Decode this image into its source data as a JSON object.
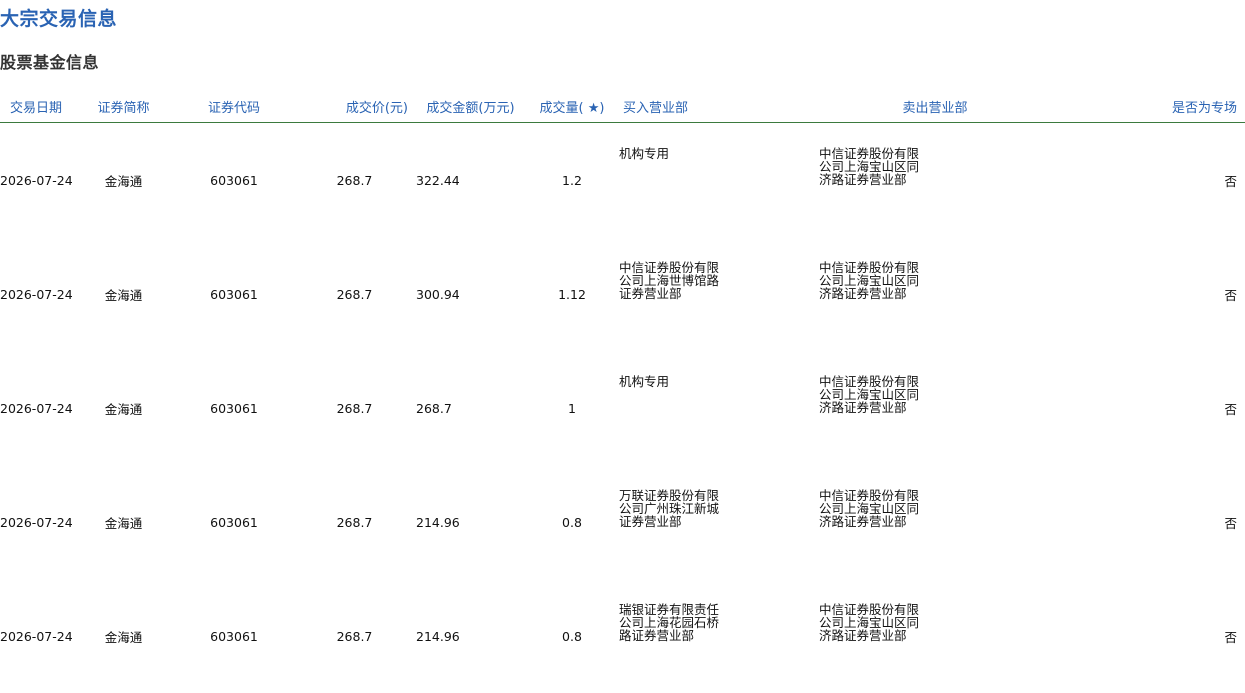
{
  "page": {
    "title": "大宗交易信息",
    "section_title": "股票基金信息"
  },
  "table": {
    "headers": {
      "date": "交易日期",
      "name": "证券简称",
      "code": "证券代码",
      "price": "成交价(元)",
      "amount": "成交金额(万元)",
      "volume": "成交量( ★)",
      "buyer": "买入营业部",
      "seller": "卖出营业部",
      "special": "是否为专场"
    },
    "rows": [
      {
        "date": "2026-07-24",
        "name": "金海通",
        "code": "603061",
        "price": "268.7",
        "amount": "322.44",
        "volume": "1.2",
        "buyer": "机构专用",
        "seller": "中信证券股份有限公司上海宝山区同济路证券营业部",
        "special": "否"
      },
      {
        "date": "2026-07-24",
        "name": "金海通",
        "code": "603061",
        "price": "268.7",
        "amount": "300.94",
        "volume": "1.12",
        "buyer": "中信证券股份有限公司上海世博馆路证券营业部",
        "seller": "中信证券股份有限公司上海宝山区同济路证券营业部",
        "special": "否"
      },
      {
        "date": "2026-07-24",
        "name": "金海通",
        "code": "603061",
        "price": "268.7",
        "amount": "268.7",
        "volume": "1",
        "buyer": "机构专用",
        "seller": "中信证券股份有限公司上海宝山区同济路证券营业部",
        "special": "否"
      },
      {
        "date": "2026-07-24",
        "name": "金海通",
        "code": "603061",
        "price": "268.7",
        "amount": "214.96",
        "volume": "0.8",
        "buyer": "万联证券股份有限公司广州珠江新城证券营业部",
        "seller": "中信证券股份有限公司上海宝山区同济路证券营业部",
        "special": "否"
      },
      {
        "date": "2026-07-24",
        "name": "金海通",
        "code": "603061",
        "price": "268.7",
        "amount": "214.96",
        "volume": "0.8",
        "buyer": "瑞银证券有限责任公司上海花园石桥路证券营业部",
        "seller": "中信证券股份有限公司上海宝山区同济路证券营业部",
        "special": "否"
      }
    ]
  },
  "colors": {
    "title": "#2a63b3",
    "header_text": "#2a63b3",
    "header_rule": "#3b7a3e",
    "section_title": "#333333"
  }
}
